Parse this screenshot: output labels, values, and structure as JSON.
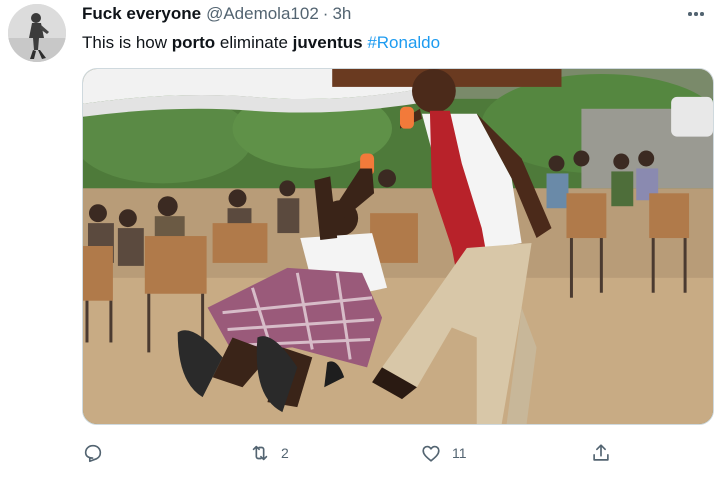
{
  "tweet": {
    "display_name": "Fuck everyone",
    "handle": "@Ademola102",
    "separator": "·",
    "time": "3h",
    "text_parts": [
      "This is how ",
      "porto",
      " eliminate ",
      "juventus",
      " ",
      "#Ronaldo"
    ],
    "hashtag_color": "#1d9bf0"
  },
  "media": {
    "description_icon": "photo"
  },
  "actions": {
    "reply_icon": "reply-icon",
    "reply_count": "",
    "retweet_icon": "retweet-icon",
    "retweet_count": "2",
    "like_icon": "heart-icon",
    "like_count": "11",
    "share_icon": "share-icon"
  }
}
